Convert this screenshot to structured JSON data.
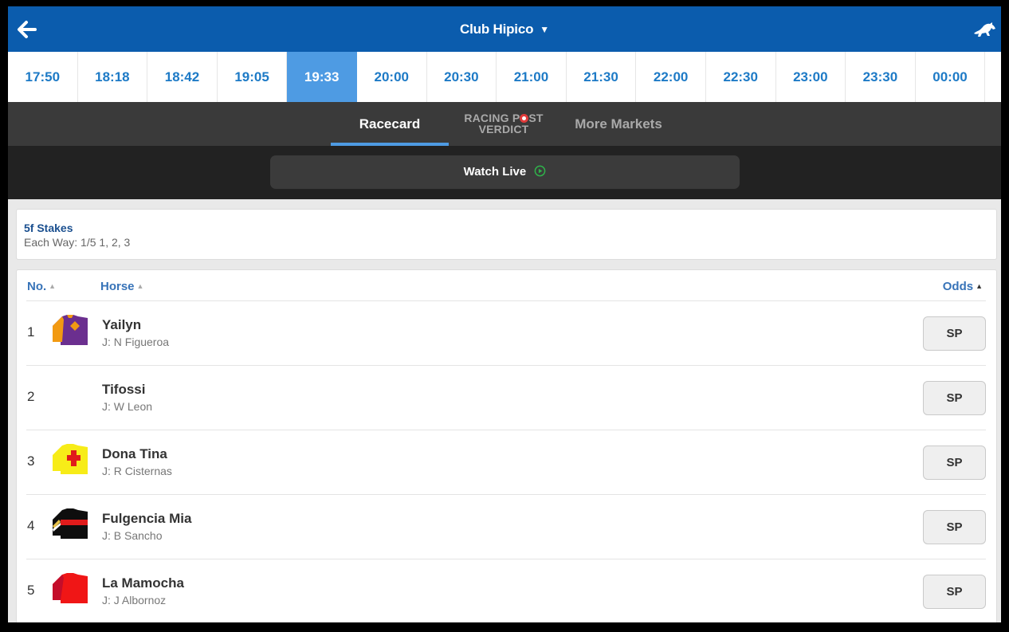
{
  "header": {
    "venue": "Club Hipico",
    "colors": {
      "bar": "#0b5cad"
    }
  },
  "times": [
    {
      "label": "17:50",
      "active": false
    },
    {
      "label": "18:18",
      "active": false
    },
    {
      "label": "18:42",
      "active": false
    },
    {
      "label": "19:05",
      "active": false
    },
    {
      "label": "19:33",
      "active": true
    },
    {
      "label": "20:00",
      "active": false
    },
    {
      "label": "20:30",
      "active": false
    },
    {
      "label": "21:00",
      "active": false
    },
    {
      "label": "21:30",
      "active": false
    },
    {
      "label": "22:00",
      "active": false
    },
    {
      "label": "22:30",
      "active": false
    },
    {
      "label": "23:00",
      "active": false
    },
    {
      "label": "23:30",
      "active": false
    },
    {
      "label": "00:00",
      "active": false
    }
  ],
  "tabs": {
    "racecard": "Racecard",
    "verdict_line1a": "RACING P",
    "verdict_line1b": "ST",
    "verdict_line2": "VERDICT",
    "markets": "More Markets"
  },
  "watch_live": "Watch Live",
  "race": {
    "name": "5f Stakes",
    "each_way": "Each Way: 1/5 1, 2, 3"
  },
  "columns": {
    "no": "No.",
    "horse": "Horse",
    "odds": "Odds"
  },
  "runners": [
    {
      "no": "1",
      "name": "Yailyn",
      "jockey": "J: N Figueroa",
      "odds": "SP",
      "silk": "purple-orange-diamond"
    },
    {
      "no": "2",
      "name": "Tifossi",
      "jockey": "J: W Leon",
      "odds": "SP",
      "silk": "none"
    },
    {
      "no": "3",
      "name": "Dona Tina",
      "jockey": "J: R Cisternas",
      "odds": "SP",
      "silk": "yellow-red-cross"
    },
    {
      "no": "4",
      "name": "Fulgencia Mia",
      "jockey": "J: B Sancho",
      "odds": "SP",
      "silk": "black-red-hoop"
    },
    {
      "no": "5",
      "name": "La Mamocha",
      "jockey": "J: J Albornoz",
      "odds": "SP",
      "silk": "red"
    }
  ]
}
